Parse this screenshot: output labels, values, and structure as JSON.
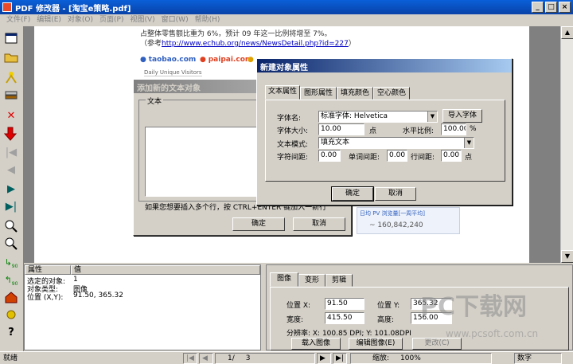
{
  "window": {
    "title": "PDF 修改器 - [淘宝e策略.pdf]",
    "minimize": "_",
    "maximize": "□",
    "close": "×"
  },
  "menu": [
    "文件(F)",
    "编辑(E)",
    "对象(O)",
    "页面(P)",
    "视图(V)",
    "窗口(W)",
    "帮助(H)"
  ],
  "document": {
    "line1": "占整体零售额比重为 6%，预计 09 年这一比例将增至 7%。",
    "ref_prefix": "（参考",
    "ref_link": "http://www.echub.org/news/NewsDetail.php?id=227",
    "ref_suffix": "）",
    "legend_taobao": "taobao.com",
    "legend_paipai": "paipai.com",
    "daily_visitors": "Daily Unique Visitors",
    "pv_label": "日均 PV 浏览量[一周平均]",
    "pv_value": "~ 160,842,240"
  },
  "add_text_dialog": {
    "title": "添加新的文本对象",
    "group_label": "文本",
    "hint": "如果您想要插入多个行，按 CTRL+ENTER 键加入一新行",
    "ok": "确定",
    "cancel": "取消"
  },
  "props_dialog": {
    "title": "新建对象属性",
    "tabs": [
      "文本属性",
      "图形属性",
      "填充颜色",
      "空心颜色"
    ],
    "font_label": "字体名:",
    "font_value": "标准字体: Helvetica",
    "import_font": "导入字体",
    "size_label": "字体大小:",
    "size_value": "10.00",
    "size_unit": "点",
    "hscale_label": "水平比例:",
    "hscale_value": "100.00",
    "hscale_unit": "%",
    "mode_label": "文本模式:",
    "mode_value": "填充文本",
    "char_spacing_label": "字符间距:",
    "char_spacing_value": "0.00",
    "word_spacing_label": "单词间距:",
    "word_spacing_value": "0.00",
    "line_spacing_label": "行间距:",
    "line_spacing_value": "0.00",
    "line_spacing_unit": "点",
    "ok": "确定",
    "cancel": "取消"
  },
  "property_panel": {
    "col_property": "属性",
    "col_value": "值",
    "rows": [
      {
        "k": "选定的对象:",
        "v": "1"
      },
      {
        "k": "对象类型:",
        "v": "图像"
      },
      {
        "k": "位置 (X,Y):",
        "v": "91.50, 365.32"
      }
    ]
  },
  "image_panel": {
    "tabs": [
      "图像",
      "变形",
      "剪辑"
    ],
    "pos_x_label": "位置 X:",
    "pos_x_value": "91.50",
    "pos_y_label": "位置 Y:",
    "pos_y_value": "365.32",
    "width_label": "宽度:",
    "width_value": "415.50",
    "height_label": "高度:",
    "height_value": "156.00",
    "resolution": "分辨率: X: 100.85 DPI; Y: 101.08DPI",
    "load_image": "载入图像",
    "edit_image": "编辑图像(E)",
    "apply": "更改(C)"
  },
  "status": {
    "ready": "就绪",
    "page_current": "1/",
    "page_total": "3",
    "zoom_label": "缩放:",
    "zoom_value": "100%",
    "numlock": "数字"
  },
  "watermark": {
    "text": "PC下载网",
    "url": "www.pcsoft.com.cn"
  }
}
